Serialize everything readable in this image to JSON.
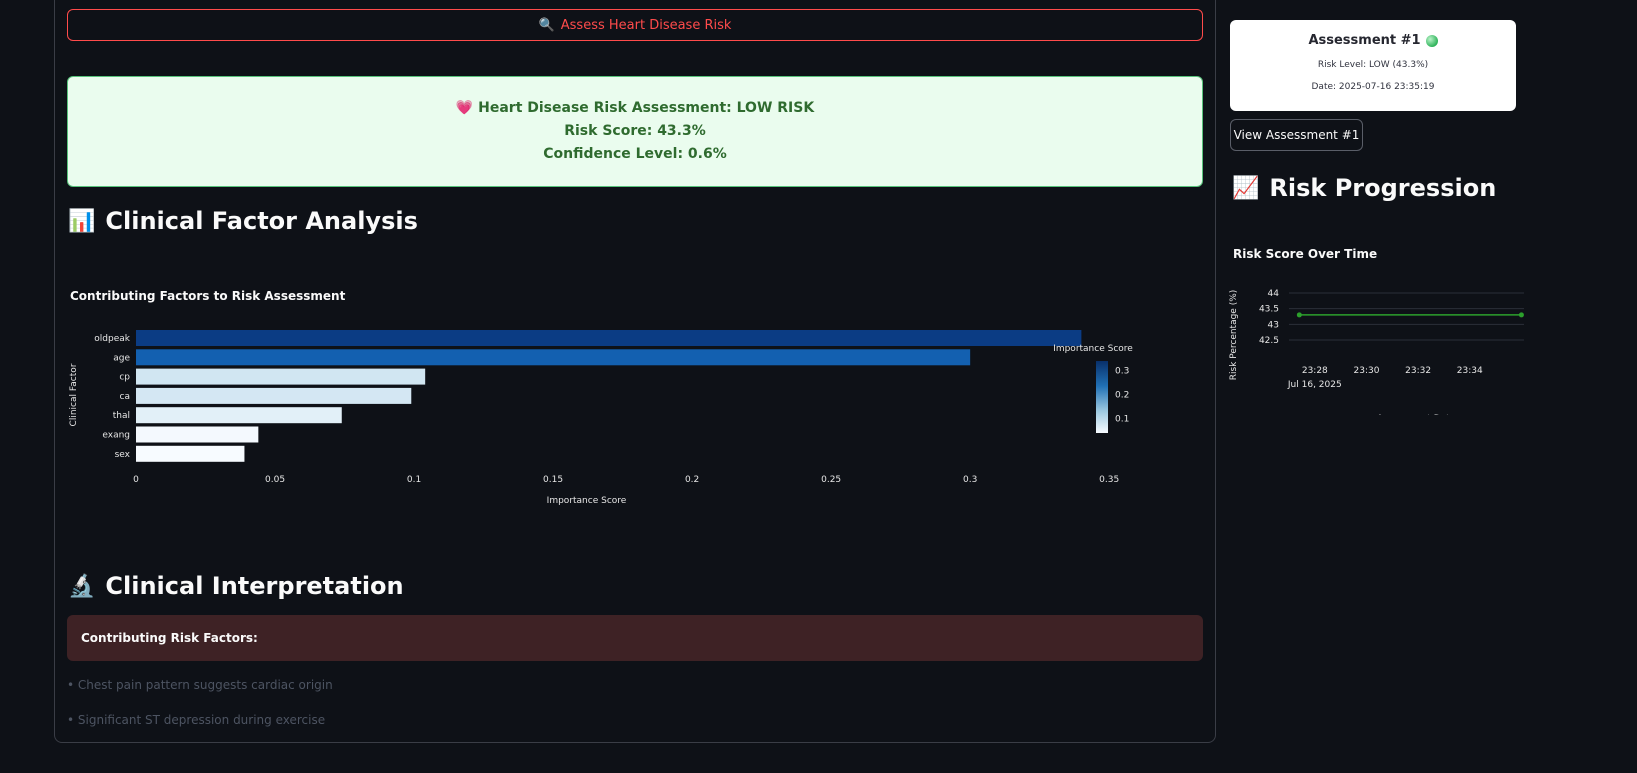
{
  "assess_button": {
    "icon": "magnifier-icon",
    "icon_glyph": "🔍",
    "label": "Assess Heart Disease Risk"
  },
  "result": {
    "icon_glyph": "💗",
    "title": "Heart Disease Risk Assessment: LOW RISK",
    "risk_score": "Risk Score: 43.3%",
    "confidence": "Confidence Level: 0.6%",
    "color": "#2f6b2f",
    "bg": "#eafcee"
  },
  "factor_section": {
    "icon_glyph": "📊",
    "title": "Clinical Factor Analysis"
  },
  "interp_section": {
    "icon_glyph": "🔬",
    "title": "Clinical Interpretation"
  },
  "interpretation": {
    "box_title": "Contributing Risk Factors:",
    "bullets": [
      "• Chest pain pattern suggests cardiac origin",
      "• Significant ST depression during exercise"
    ]
  },
  "sidebar": {
    "card": {
      "title": "Assessment #1",
      "risk_level": "Risk Level: LOW (43.3%)",
      "date": "Date: 2025-07-16 23:35:19"
    },
    "view_button": "View Assessment #1",
    "progression": {
      "icon_glyph": "📈",
      "title": "Risk Progression"
    }
  },
  "chart_data": [
    {
      "type": "bar",
      "orientation": "horizontal",
      "title": "Contributing Factors to Risk Assessment",
      "xlabel": "Importance Score",
      "ylabel": "Clinical Factor",
      "categories": [
        "oldpeak",
        "age",
        "cp",
        "ca",
        "thal",
        "exang",
        "sex"
      ],
      "values": [
        0.34,
        0.3,
        0.104,
        0.099,
        0.074,
        0.044,
        0.039
      ],
      "xlim": [
        0,
        0.36
      ],
      "xticks": [
        "0",
        "0.05",
        "0.1",
        "0.15",
        "0.2",
        "0.25",
        "0.3",
        "0.35"
      ],
      "colorbar": {
        "title": "Importance Score",
        "ticks": [
          "0.3",
          "0.2",
          "0.1"
        ],
        "range": [
          0.039,
          0.34
        ],
        "low_color": "#f7fbff",
        "high_color": "#08306b"
      }
    },
    {
      "type": "line",
      "title": "Risk Score Over Time",
      "xlabel": "Assessment Date",
      "ylabel": "Risk Percentage (%)",
      "xticks": [
        "23:28",
        "23:30",
        "23:32",
        "23:34"
      ],
      "x_date_label": "Jul 16, 2025",
      "yticks": [
        "44",
        "43.5",
        "43",
        "42.5"
      ],
      "ylim": [
        42.5,
        44
      ],
      "series": [
        {
          "x": [
            "23:27.4",
            "23:36.0"
          ],
          "values": [
            43.3,
            43.3
          ],
          "color": "#2ca02c"
        }
      ]
    }
  ]
}
